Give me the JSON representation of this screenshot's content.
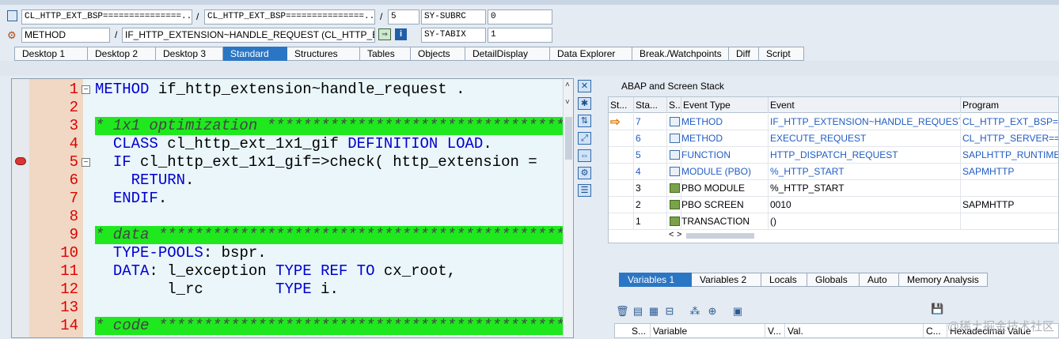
{
  "header": {
    "row1": {
      "program": "CL_HTTP_EXT_BSP===============...",
      "include": "CL_HTTP_EXT_BSP===============...",
      "sep1": "/",
      "sep2": "/",
      "line": "5",
      "sysvar_label": "SY-SUBRC",
      "sysvar_value": "0"
    },
    "row2": {
      "type": "METHOD",
      "sep": "/",
      "name": "IF_HTTP_EXTENSION~HANDLE_REQUEST (CL_HTTP_E...",
      "sysvar_label": "SY-TABIX",
      "sysvar_value": "1"
    }
  },
  "tabs": [
    "Desktop 1",
    "Desktop 2",
    "Desktop 3",
    "Standard",
    "Structures",
    "Tables",
    "Objects",
    "DetailDisplay",
    "Data Explorer",
    "Break./Watchpoints",
    "Diff",
    "Script"
  ],
  "active_tab": "Standard",
  "editor": {
    "lines": [
      {
        "num": "1",
        "segments": [
          [
            "kw",
            "METHOD"
          ],
          [
            "plain",
            " if_http_extension~handle_request ."
          ]
        ]
      },
      {
        "num": "2",
        "segments": []
      },
      {
        "num": "3",
        "segments": [
          [
            "cm",
            "* 1x1 optimization ********************************************************"
          ]
        ],
        "comment": true
      },
      {
        "num": "4",
        "segments": [
          [
            "plain",
            "  "
          ],
          [
            "kw",
            "CLASS"
          ],
          [
            "plain",
            " cl_http_ext_1x1_gif "
          ],
          [
            "kw",
            "DEFINITION LOAD"
          ],
          [
            "plain",
            "."
          ]
        ]
      },
      {
        "num": "5",
        "segments": [
          [
            "plain",
            "  "
          ],
          [
            "kw",
            "IF"
          ],
          [
            "plain",
            " cl_http_ext_1x1_gif=>check( http_extension = "
          ]
        ]
      },
      {
        "num": "6",
        "segments": [
          [
            "plain",
            "    "
          ],
          [
            "kw",
            "RETURN"
          ],
          [
            "plain",
            "."
          ]
        ]
      },
      {
        "num": "7",
        "segments": [
          [
            "plain",
            "  "
          ],
          [
            "kw",
            "ENDIF"
          ],
          [
            "plain",
            "."
          ]
        ]
      },
      {
        "num": "8",
        "segments": []
      },
      {
        "num": "9",
        "segments": [
          [
            "cm",
            "* data **********************************************************************"
          ]
        ],
        "comment": true
      },
      {
        "num": "10",
        "segments": [
          [
            "plain",
            "  "
          ],
          [
            "kw",
            "TYPE-POOLS"
          ],
          [
            "plain",
            ": bspr."
          ]
        ]
      },
      {
        "num": "11",
        "segments": [
          [
            "plain",
            "  "
          ],
          [
            "kw",
            "DATA"
          ],
          [
            "plain",
            ": l_exception "
          ],
          [
            "kw",
            "TYPE REF TO"
          ],
          [
            "plain",
            " cx_root,"
          ]
        ]
      },
      {
        "num": "12",
        "segments": [
          [
            "plain",
            "        l_rc        "
          ],
          [
            "kw",
            "TYPE"
          ],
          [
            "plain",
            " i."
          ]
        ]
      },
      {
        "num": "13",
        "segments": []
      },
      {
        "num": "14",
        "segments": [
          [
            "cm",
            "* code **********************************************************************"
          ]
        ],
        "comment": true
      }
    ]
  },
  "stack": {
    "title": "ABAP and Screen Stack",
    "columns": [
      "St...",
      "Sta...",
      "S...",
      "Event Type",
      "Event",
      "Program"
    ],
    "rows": [
      {
        "level": "7",
        "type": "METHOD",
        "event": "IF_HTTP_EXTENSION~HANDLE_REQUEST",
        "program": "CL_HTTP_EXT_BSP====",
        "link": true,
        "current": true,
        "icon": "method"
      },
      {
        "level": "6",
        "type": "METHOD",
        "event": "EXECUTE_REQUEST",
        "program": "CL_HTTP_SERVER=====",
        "link": true,
        "icon": "method"
      },
      {
        "level": "5",
        "type": "FUNCTION",
        "event": "HTTP_DISPATCH_REQUEST",
        "program": "SAPLHTTP_RUNTIME",
        "link": true,
        "icon": "method"
      },
      {
        "level": "4",
        "type": "MODULE (PBO)",
        "event": "%_HTTP_START",
        "program": "SAPMHTTP",
        "link": true,
        "icon": "method"
      },
      {
        "level": "3",
        "type": "PBO MODULE",
        "event": "%_HTTP_START",
        "program": "",
        "link": false,
        "icon": "pbo"
      },
      {
        "level": "2",
        "type": "PBO SCREEN",
        "event": "0010",
        "program": "SAPMHTTP",
        "link": false,
        "icon": "pbo"
      },
      {
        "level": "1",
        "type": "TRANSACTION",
        "event": "()",
        "program": "",
        "link": false,
        "icon": "pbo"
      }
    ]
  },
  "variables": {
    "tabs": [
      "Variables 1",
      "Variables 2",
      "Locals",
      "Globals",
      "Auto",
      "Memory Analysis"
    ],
    "active_tab": "Variables 1",
    "columns": [
      "S...",
      "Variable",
      "V...",
      "Val.",
      "C...",
      "Hexadecimal Value"
    ]
  },
  "watermark": "@稀土掘金技术社区",
  "colors": {
    "accent": "#2b76c4",
    "comment_bg": "#1fe81f",
    "keyword": "#0000d0",
    "line_number": "#e00000",
    "link": "#1f5cc4"
  }
}
